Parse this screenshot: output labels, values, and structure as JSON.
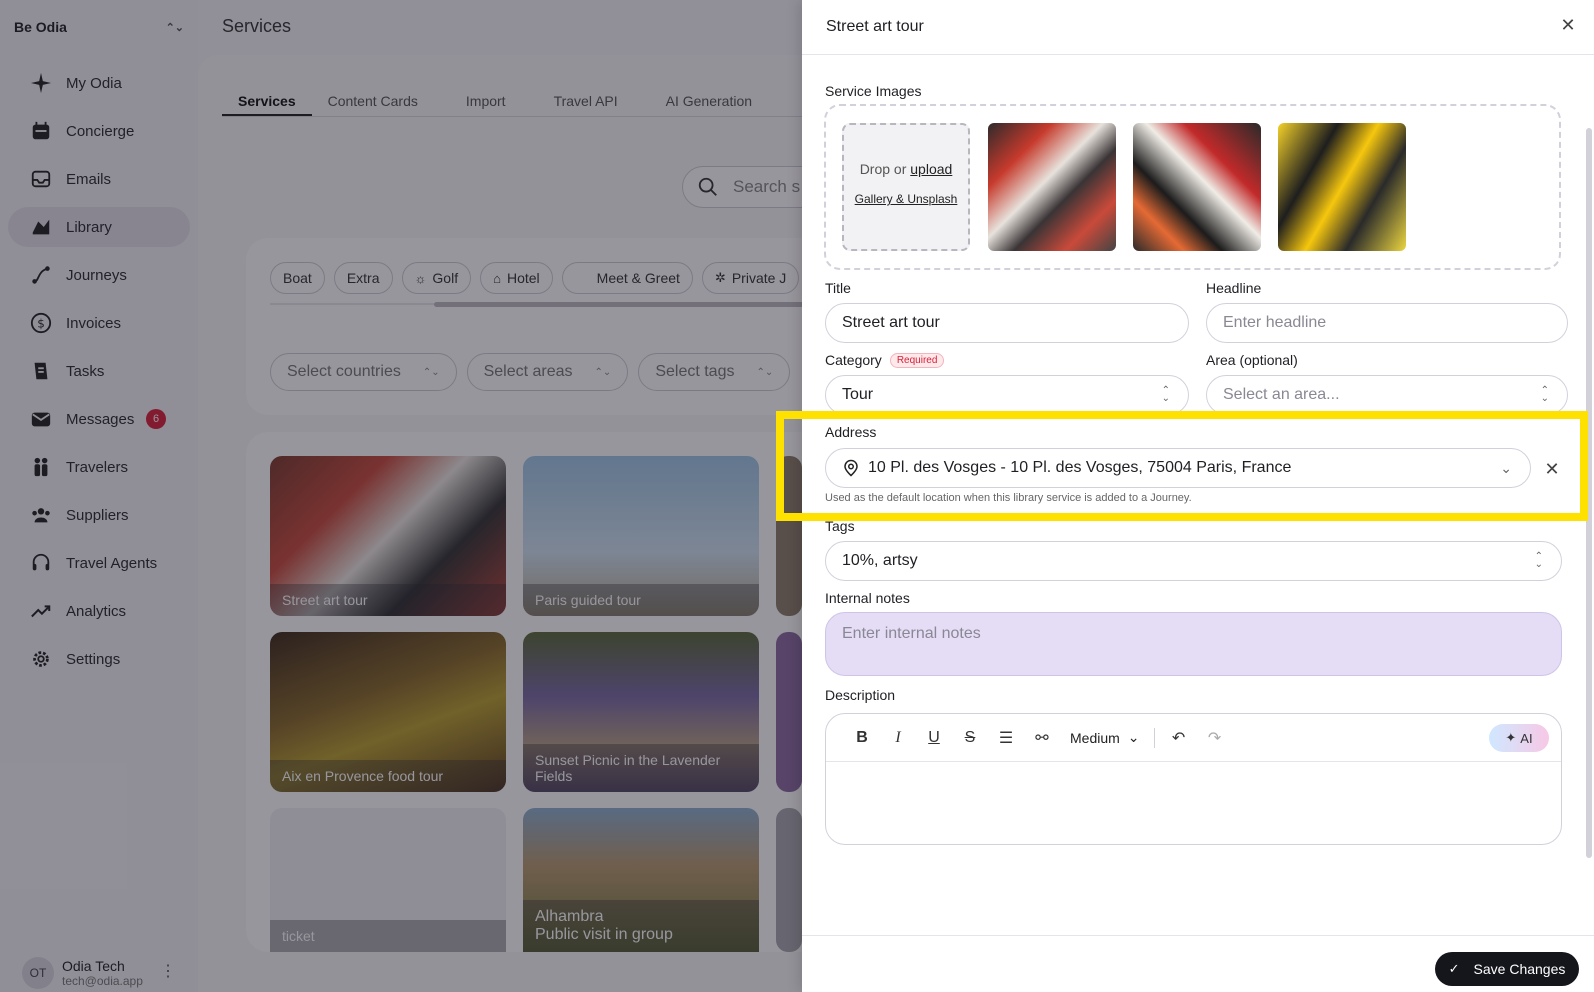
{
  "sidebar": {
    "org_name": "Be Odia",
    "items": [
      {
        "label": "My Odia",
        "icon": "sparkle-icon"
      },
      {
        "label": "Concierge",
        "icon": "calendar-icon"
      },
      {
        "label": "Emails",
        "icon": "inbox-icon"
      },
      {
        "label": "Library",
        "icon": "book-icon"
      },
      {
        "label": "Journeys",
        "icon": "route-icon"
      },
      {
        "label": "Invoices",
        "icon": "dollar-icon"
      },
      {
        "label": "Tasks",
        "icon": "clipboard-icon"
      },
      {
        "label": "Messages",
        "icon": "mail-icon",
        "badge": "6"
      },
      {
        "label": "Travelers",
        "icon": "people-icon"
      },
      {
        "label": "Suppliers",
        "icon": "group-icon"
      },
      {
        "label": "Travel Agents",
        "icon": "headset-icon"
      },
      {
        "label": "Analytics",
        "icon": "trend-icon"
      },
      {
        "label": "Settings",
        "icon": "gear-icon"
      }
    ],
    "active": "Library",
    "user": {
      "initials": "OT",
      "name": "Odia Tech",
      "email": "tech@odia.app"
    }
  },
  "main": {
    "title": "Services",
    "tabs": [
      "Services",
      "Content Cards",
      "Import",
      "Travel API",
      "AI Generation"
    ],
    "search_placeholder": "Search s",
    "chips": [
      {
        "label": "Boat",
        "icon": ""
      },
      {
        "label": "Extra",
        "icon": ""
      },
      {
        "label": "Golf",
        "icon": "☼"
      },
      {
        "label": "Hotel",
        "icon": "⌂"
      },
      {
        "label": "Meet & Greet",
        "icon": ""
      },
      {
        "label": "Private J",
        "icon": "✲"
      }
    ],
    "filters": [
      "Select countries",
      "Select areas",
      "Select tags"
    ],
    "tiles": [
      {
        "label": "Street art tour"
      },
      {
        "label": "Paris guided tour"
      },
      {
        "label": "Aix en Provence food tour"
      },
      {
        "label": "Sunset Picnic in the Lavender Fields"
      },
      {
        "label": "ticket"
      },
      {
        "label": "Alhambra"
      }
    ],
    "tile_sub": "Public visit in group"
  },
  "drawer": {
    "title": "Street art tour",
    "service_images_label": "Service Images",
    "drop_text": "Drop or",
    "upload_link": "upload",
    "gallery_link": "Gallery & Unsplash",
    "title_label": "Title",
    "title_value": "Street art tour",
    "headline_label": "Headline",
    "headline_placeholder": "Enter headline",
    "category_label": "Category",
    "required_badge": "Required",
    "category_value": "Tour",
    "area_label": "Area (optional)",
    "area_placeholder": "Select an area...",
    "address_label": "Address",
    "address_value": "10 Pl. des Vosges - 10 Pl. des Vosges, 75004 Paris, France",
    "address_hint": "Used as the default location when this library service is added to a Journey.",
    "tags_label": "Tags",
    "tags_value": "10%, artsy",
    "notes_label": "Internal notes",
    "notes_placeholder": "Enter internal notes",
    "description_label": "Description",
    "text_size": "Medium",
    "ai_label": "AI",
    "save_label": "Save Changes"
  },
  "colors": {
    "highlight": "#ffe100",
    "notes_bg": "#e5dcf6",
    "badge": "#d9203a",
    "save_bg": "#15161c"
  }
}
